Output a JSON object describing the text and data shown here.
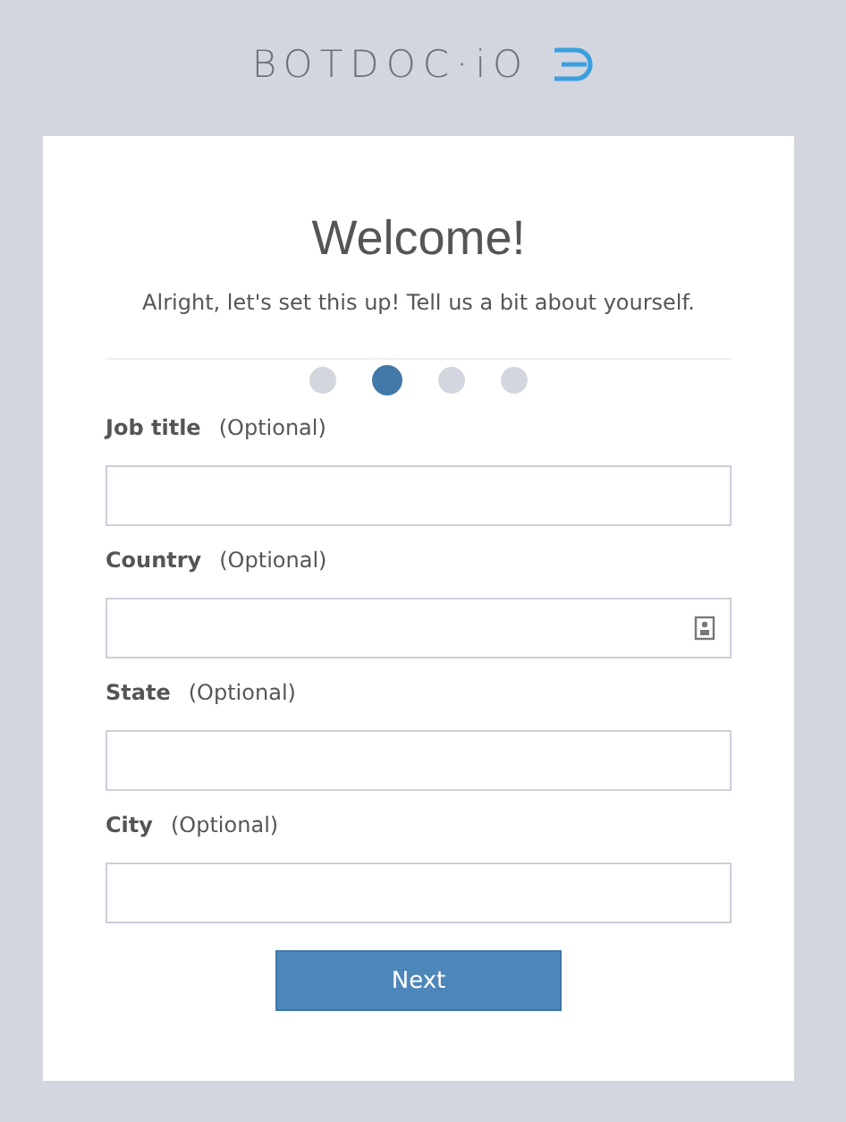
{
  "logo": {
    "text": "BOTDOC·iO"
  },
  "heading": "Welcome!",
  "subtitle": "Alright, let's set this up! Tell us a bit about yourself.",
  "steps": [
    {
      "selected": false
    },
    {
      "selected": true
    },
    {
      "selected": false
    },
    {
      "selected": false
    }
  ],
  "fields": [
    {
      "label": "Job title",
      "hint": "(Optional)",
      "kind": "text"
    },
    {
      "label": "Country",
      "hint": "(Optional)",
      "kind": "contact"
    },
    {
      "label": "State",
      "hint": "(Optional)",
      "kind": "text"
    },
    {
      "label": "City",
      "hint": "(Optional)",
      "kind": "text"
    }
  ],
  "button": "Next"
}
